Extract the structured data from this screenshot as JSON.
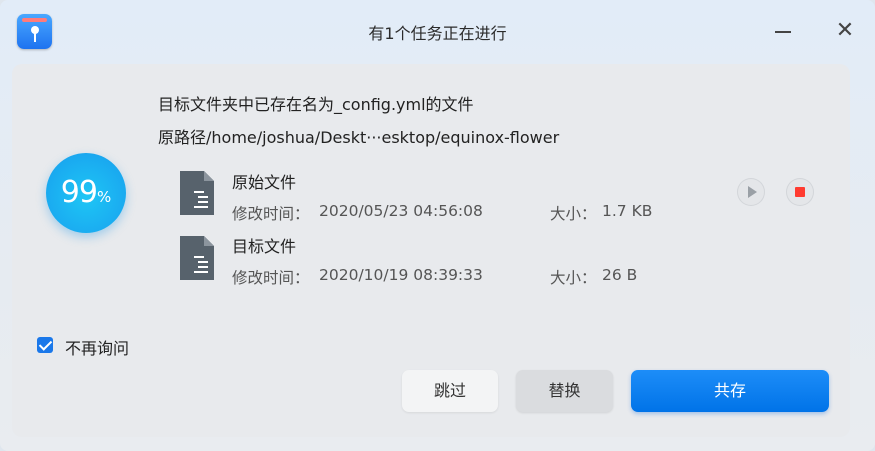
{
  "window": {
    "title": "有1个任务正在进行"
  },
  "progress": {
    "value": "99",
    "unit": "%"
  },
  "message": {
    "line1": "目标文件夹中已存在名为_config.yml的文件",
    "line2": "原路径/home/joshua/Deskt···esktop/equinox-flower"
  },
  "files": [
    {
      "name": "原始文件",
      "modified_label": "修改时间：",
      "modified": "2020/05/23 04:56:08",
      "size_label": "大小：",
      "size": "1.7 KB"
    },
    {
      "name": "目标文件",
      "modified_label": "修改时间：",
      "modified": "2020/10/19 08:39:33",
      "size_label": "大小：",
      "size": "26 B"
    }
  ],
  "options": {
    "dont_ask_again": "不再询问",
    "checked": true
  },
  "buttons": {
    "skip": "跳过",
    "replace": "替换",
    "keep_both": "共存"
  },
  "colors": {
    "accent": "#0f7ff0",
    "progress": "#1ab4f2",
    "stop": "#ff3b30"
  }
}
